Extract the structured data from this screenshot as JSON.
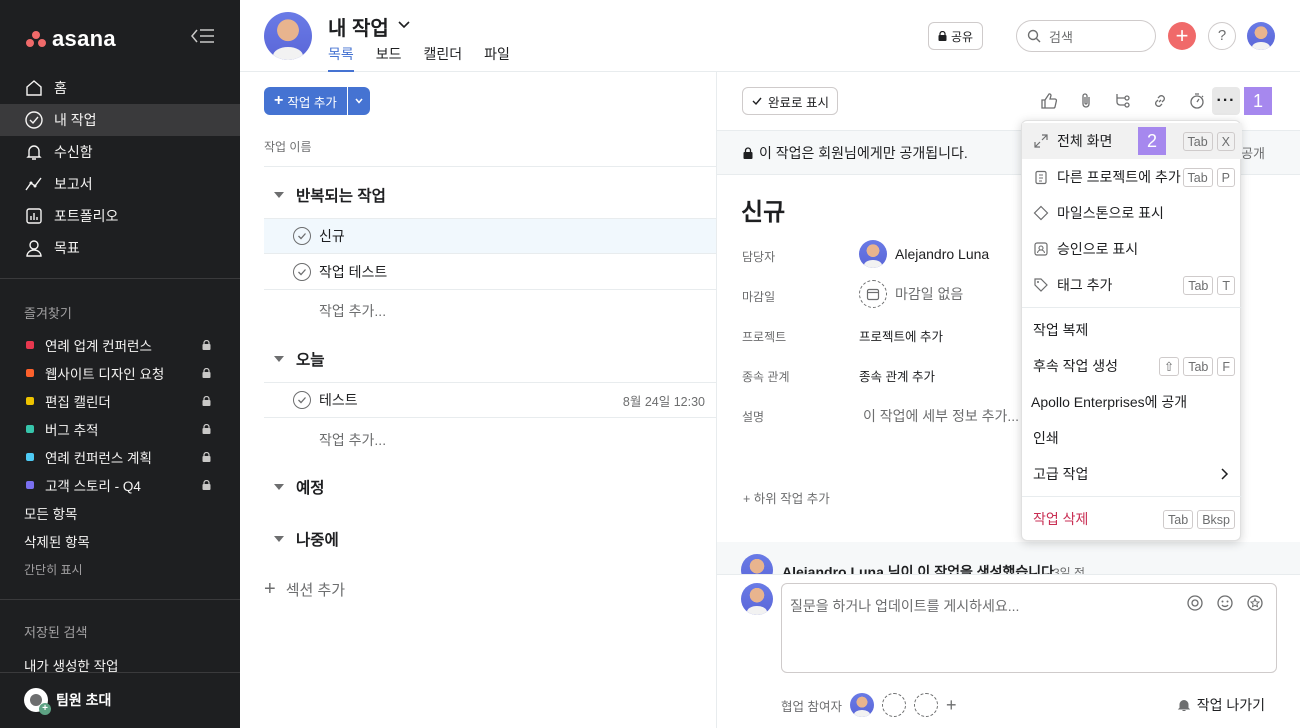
{
  "sidebar": {
    "logo": "asana",
    "nav": [
      {
        "label": "홈",
        "icon": "home-icon"
      },
      {
        "label": "내 작업",
        "icon": "check-circle-icon",
        "active": true
      },
      {
        "label": "수신함",
        "icon": "bell-icon"
      },
      {
        "label": "보고서",
        "icon": "chart-line-icon"
      },
      {
        "label": "포트폴리오",
        "icon": "portfolio-icon"
      },
      {
        "label": "목표",
        "icon": "person-icon"
      }
    ],
    "favorites_title": "즐겨찾기",
    "favorites": [
      {
        "label": "연례 업계 컨퍼런스",
        "color": "#e8384f"
      },
      {
        "label": "웹사이트 디자인 요청",
        "color": "#fd612c"
      },
      {
        "label": "편집 캘린더",
        "color": "#eec300"
      },
      {
        "label": "버그 추적",
        "color": "#37c5ab"
      },
      {
        "label": "연례 컨퍼런스 계획",
        "color": "#4ecbf5"
      },
      {
        "label": "고객 스토리 - Q4",
        "color": "#7a6ff0"
      }
    ],
    "all_items": "모든 항목",
    "deleted_items": "삭제된 항목",
    "show_less": "간단히 표시",
    "saved_search_title": "저장된 검색",
    "saved_search_item": "내가 생성한 작업",
    "invite": "팀원 초대"
  },
  "header": {
    "title": "내 작업",
    "tabs": [
      "목록",
      "보드",
      "캘린더",
      "파일"
    ],
    "share": "공유",
    "search_placeholder": "검색",
    "help": "?"
  },
  "list": {
    "add_task": "작업 추가",
    "column": "작업 이름",
    "sections": [
      {
        "name": "반복되는 작업"
      },
      {
        "name": "오늘"
      },
      {
        "name": "예정"
      },
      {
        "name": "나중에"
      }
    ],
    "tasks": [
      {
        "name": "신규",
        "date": ""
      },
      {
        "name": "작업 테스트",
        "date": ""
      },
      {
        "name": "테스트",
        "date": "8월 24일 12:30"
      }
    ],
    "add_row": "작업 추가...",
    "add_section": "섹션 추가"
  },
  "detail": {
    "mark_complete": "완료로 표시",
    "step1": "1",
    "private_notice": "이 작업은 회원님에게만 공개됩니다.",
    "private_right": "공개",
    "title": "신규",
    "fields": {
      "assignee_label": "담당자",
      "assignee": "Alejandro Luna",
      "due_label": "마감일",
      "due": "마감일 없음",
      "project_label": "프로젝트",
      "project": "프로젝트에 추가",
      "deps_label": "종속 관계",
      "deps": "종속 관계 추가",
      "desc_label": "설명",
      "desc": "이 작업에 세부 정보 추가..."
    },
    "add_subtask": "하위 작업 추가",
    "activity": "Alejandro Luna 님이 이 작업을 생성했습니다.",
    "activity_ago": "3일 전",
    "comment_placeholder": "질문을 하거나 업데이트를 게시하세요...",
    "collaborators": "협업 참여자",
    "leave": "작업 나가기"
  },
  "menu": {
    "step2": "2",
    "items": [
      {
        "label": "전체 화면",
        "keys": [
          "Tab",
          "X"
        ]
      },
      {
        "label": "다른 프로젝트에 추가",
        "keys": [
          "Tab",
          "P"
        ]
      },
      {
        "label": "마일스톤으로 표시",
        "keys": []
      },
      {
        "label": "승인으로 표시",
        "keys": []
      },
      {
        "label": "태그 추가",
        "keys": [
          "Tab",
          "T"
        ]
      },
      {
        "label": "작업 복제",
        "keys": []
      },
      {
        "label": "후속 작업 생성",
        "keys": [
          "⇧",
          "Tab",
          "F"
        ]
      },
      {
        "label": "Apollo Enterprises에 공개",
        "keys": []
      },
      {
        "label": "인쇄",
        "keys": []
      },
      {
        "label": "고급 작업",
        "keys": []
      },
      {
        "label": "작업 삭제",
        "keys": [
          "Tab",
          "Bksp"
        ]
      }
    ]
  }
}
